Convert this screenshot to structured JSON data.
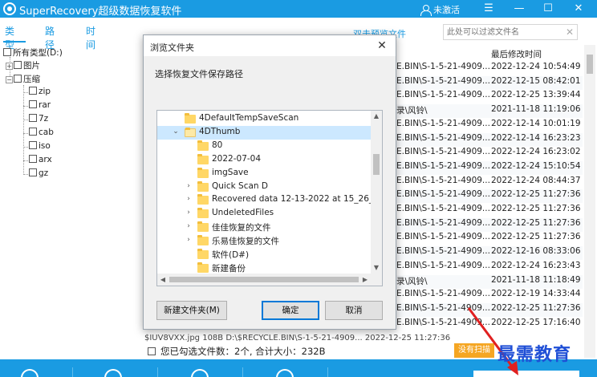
{
  "app": {
    "title": "SuperRecovery超级数据恢复软件",
    "user_label": "未激活"
  },
  "window_controls": {
    "menu": "☰",
    "minimize": "—",
    "maximize": "☐",
    "close": "✕"
  },
  "tabs": [
    "类型",
    "路径",
    "时间"
  ],
  "header": {
    "double_click_preview": "双击预览文件",
    "search_placeholder": "此处可以过滤文件名"
  },
  "tree": {
    "root": "所有类型(D:)",
    "image": "图片",
    "compress": "压缩",
    "children": [
      "zip",
      "rar",
      "7z",
      "cab",
      "iso",
      "arx",
      "gz"
    ]
  },
  "list": {
    "col_date": "最后修改时间",
    "rows": [
      {
        "path": "E.BIN\\S-1-5-21-4909...",
        "date": "2022-12-24 10:54:49"
      },
      {
        "path": "E.BIN\\S-1-5-21-4909...",
        "date": "2022-12-15 08:42:01"
      },
      {
        "path": "E.BIN\\S-1-5-21-4909...",
        "date": "2022-12-25 13:39:44"
      },
      {
        "path": "录\\风铃\\",
        "date": "2021-11-18 11:19:06"
      },
      {
        "path": "E.BIN\\S-1-5-21-4909...",
        "date": "2022-12-14 10:01:19"
      },
      {
        "path": "E.BIN\\S-1-5-21-4909...",
        "date": "2022-12-14 16:23:23"
      },
      {
        "path": "E.BIN\\S-1-5-21-4909...",
        "date": "2022-12-24 16:23:02"
      },
      {
        "path": "E.BIN\\S-1-5-21-4909...",
        "date": "2022-12-24 15:10:54"
      },
      {
        "path": "E.BIN\\S-1-5-21-4909...",
        "date": "2022-12-24 08:44:37"
      },
      {
        "path": "E.BIN\\S-1-5-21-4909...",
        "date": "2022-12-25 11:27:36"
      },
      {
        "path": "E.BIN\\S-1-5-21-4909...",
        "date": "2022-12-25 11:27:36"
      },
      {
        "path": "E.BIN\\S-1-5-21-4909...",
        "date": "2022-12-25 11:27:36"
      },
      {
        "path": "E.BIN\\S-1-5-21-4909...",
        "date": "2022-12-25 11:27:36"
      },
      {
        "path": "E.BIN\\S-1-5-21-4909...",
        "date": "2022-12-16 08:33:06"
      },
      {
        "path": "E.BIN\\S-1-5-21-4909...",
        "date": "2022-12-24 16:23:43"
      },
      {
        "path": "录\\风铃\\",
        "date": "2021-11-18 11:18:49"
      },
      {
        "path": "E.BIN\\S-1-5-21-4909...",
        "date": "2022-12-19 14:33:44"
      },
      {
        "path": "E.BIN\\S-1-5-21-4909...",
        "date": "2022-12-25 11:27:36"
      },
      {
        "path": "E.BIN\\S-1-5-21-4909...",
        "date": "2022-12-25 17:16:40"
      }
    ],
    "partial_row": "$IUV8VXX.jpg        108B      D:\\$RECYCLE.BIN\\S-1-5-21-4909...    2022-12-25 11:27:36"
  },
  "selection": {
    "info": "您已勾选文件数：2个, 合计大小：232B",
    "recover_button": "没有扫描"
  },
  "watermark": "最需教育",
  "dialog": {
    "title": "浏览文件夹",
    "close": "✕",
    "prompt": "选择恢复文件保存路径",
    "folders": [
      {
        "name": "4DefaultTempSaveScan",
        "level": 0,
        "expander": "",
        "selected": false,
        "open": false
      },
      {
        "name": "4DThumb",
        "level": 0,
        "expander": "⌄",
        "selected": true,
        "open": true
      },
      {
        "name": "80",
        "level": 1,
        "expander": "",
        "selected": false,
        "open": false
      },
      {
        "name": "2022-07-04",
        "level": 1,
        "expander": "",
        "selected": false,
        "open": false
      },
      {
        "name": "imgSave",
        "level": 1,
        "expander": "",
        "selected": false,
        "open": false
      },
      {
        "name": "Quick Scan D",
        "level": 1,
        "expander": "›",
        "selected": false,
        "open": false
      },
      {
        "name": "Recovered data 12-13-2022 at 15_26_",
        "level": 1,
        "expander": "›",
        "selected": false,
        "open": false
      },
      {
        "name": "UndeletedFiles",
        "level": 1,
        "expander": "›",
        "selected": false,
        "open": false
      },
      {
        "name": "佳佳恢复的文件",
        "level": 1,
        "expander": "›",
        "selected": false,
        "open": false
      },
      {
        "name": "乐易佳恢复的文件",
        "level": 1,
        "expander": "›",
        "selected": false,
        "open": false
      },
      {
        "name": "软件(D#)",
        "level": 1,
        "expander": "",
        "selected": false,
        "open": false
      },
      {
        "name": "新建备份",
        "level": 1,
        "expander": "",
        "selected": false,
        "open": false
      }
    ],
    "scroll_up": "▲",
    "scroll_down": "▼",
    "scroll_left": "◀",
    "scroll_right": "▶",
    "new_folder_button": "新建文件夹(M)",
    "ok_button": "确定",
    "cancel_button": "取消"
  }
}
